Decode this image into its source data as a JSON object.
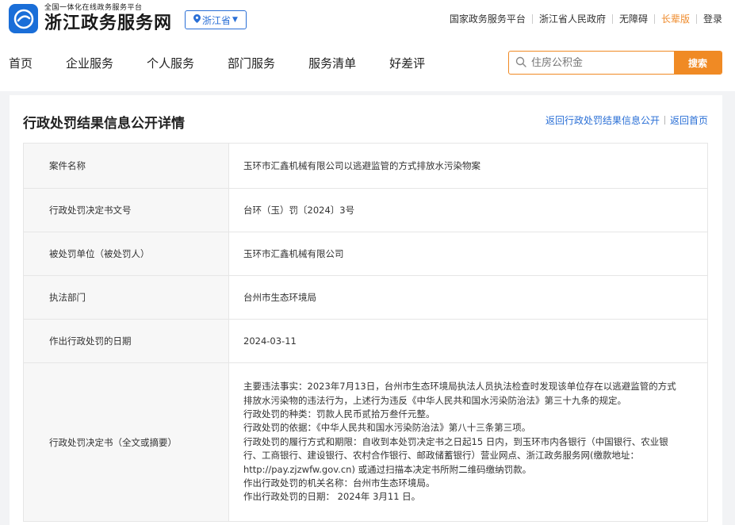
{
  "header": {
    "logo_subtitle": "全国一体化在线政务服务平台",
    "logo_title": "浙江政务服务网",
    "region": "浙江省",
    "top_links": [
      "国家政务服务平台",
      "浙江省人民政府",
      "无障碍",
      "长辈版",
      "登录"
    ]
  },
  "nav": {
    "items": [
      "首页",
      "企业服务",
      "个人服务",
      "部门服务",
      "服务清单",
      "好差评"
    ]
  },
  "search": {
    "placeholder": "住房公积金",
    "button": "搜索"
  },
  "page": {
    "title": "行政处罚结果信息公开详情",
    "back_list": "返回行政处罚结果信息公开",
    "back_home": "返回首页"
  },
  "details": {
    "rows": [
      {
        "label": "案件名称",
        "value": "玉环市汇鑫机械有限公司以逃避监管的方式排放水污染物案"
      },
      {
        "label": "行政处罚决定书文号",
        "value": "台环（玉）罚〔2024〕3号"
      },
      {
        "label": "被处罚单位（被处罚人）",
        "value": "玉环市汇鑫机械有限公司"
      },
      {
        "label": "执法部门",
        "value": "台州市生态环境局"
      },
      {
        "label": "作出行政处罚的日期",
        "value": "2024-03-11"
      }
    ],
    "summary_label": "行政处罚决定书（全文或摘要）",
    "summary_lines": [
      "主要违法事实：2023年7月13日，台州市生态环境局执法人员执法检查时发现该单位存在以逃避监管的方式",
      "排放水污染物的违法行为，上述行为违反《中华人民共和国水污染防治法》第三十九条的规定。",
      "行政处罚的种类：罚款人民币贰拾万叁仟元整。",
      "行政处罚的依据：《中华人民共和国水污染防治法》第八十三条第三项。",
      "行政处罚的履行方式和期限：自收到本处罚决定书之日起15 日内，到玉环市内各银行（中国银行、农业银",
      "行、工商银行、建设银行、农村合作银行、邮政储蓄银行）营业网点、浙江政务服务网(缴款地址：",
      "http://pay.zjzwfw.gov.cn) 或通过扫描本决定书所附二维码缴纳罚款。",
      "作出行政处罚的机关名称：台州市生态环境局。",
      "作出行政处罚的日期： 2024年 3月11 日。"
    ]
  }
}
